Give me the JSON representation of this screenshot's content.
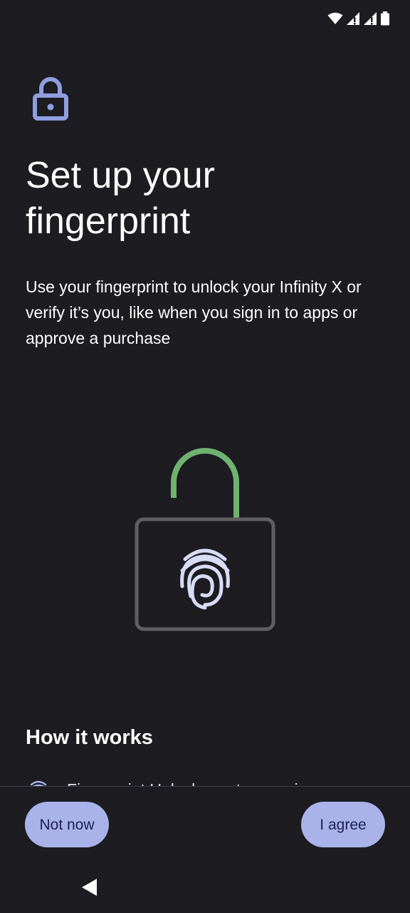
{
  "status_bar": {
    "icons": [
      "wifi-icon",
      "signal-icon",
      "signal-icon",
      "battery-icon"
    ]
  },
  "header": {
    "icon": "lock-icon",
    "title": "Set up your fingerprint",
    "description": "Use your fingerprint to unlock your Infinity X or verify it’s you, like when you sign in to apps or approve a purchase"
  },
  "illustration": {
    "icon": "unlocked-padlock-fingerprint",
    "colors": {
      "shackle": "#6fb36f",
      "body_border": "#5f5f63",
      "fingerprint": "#d9dcf7"
    }
  },
  "how_it_works": {
    "heading": "How it works",
    "items": [
      {
        "icon": "fingerprint-icon",
        "text": "Fingerprint Unlock creates a unique"
      }
    ]
  },
  "footer": {
    "not_now_label": "Not now",
    "agree_label": "I agree"
  },
  "navigation": {
    "back_icon": "back-triangle-icon"
  },
  "colors": {
    "background": "#1c1c21",
    "accent": "#a9b3ea",
    "accent_text": "#1c2050",
    "lock_icon": "#8f9ee0"
  }
}
